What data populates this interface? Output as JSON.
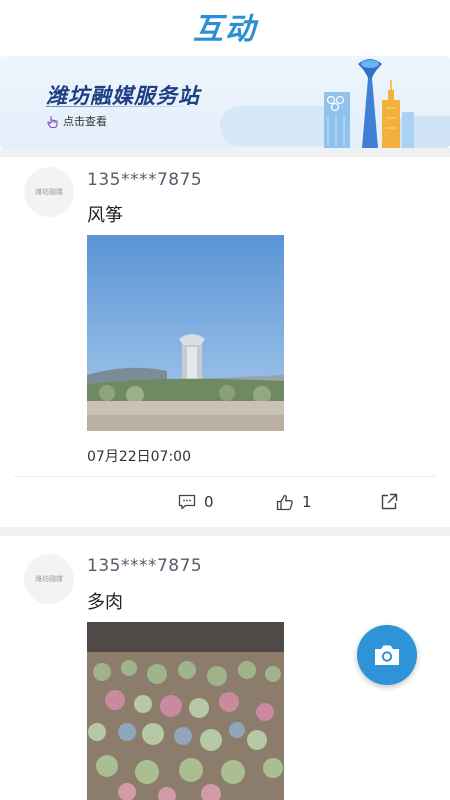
{
  "header": {
    "title": "互动"
  },
  "banner": {
    "title": "潍坊融媒服务站",
    "subtitle": "点击查看"
  },
  "posts": [
    {
      "username": "135****7875",
      "avatar_text": "潍坊融媒",
      "content": "风筝",
      "timestamp": "07月22日07:00",
      "comments": "0",
      "likes": "1"
    },
    {
      "username": "135****7875",
      "avatar_text": "潍坊融媒",
      "content": "多肉"
    }
  ],
  "colors": {
    "accent": "#2f93d8",
    "title": "#2a8fd4",
    "banner_title": "#1d3f84"
  },
  "icons": [
    "comment-icon",
    "like-icon",
    "share-icon",
    "camera-icon",
    "hand-pointer-icon"
  ]
}
